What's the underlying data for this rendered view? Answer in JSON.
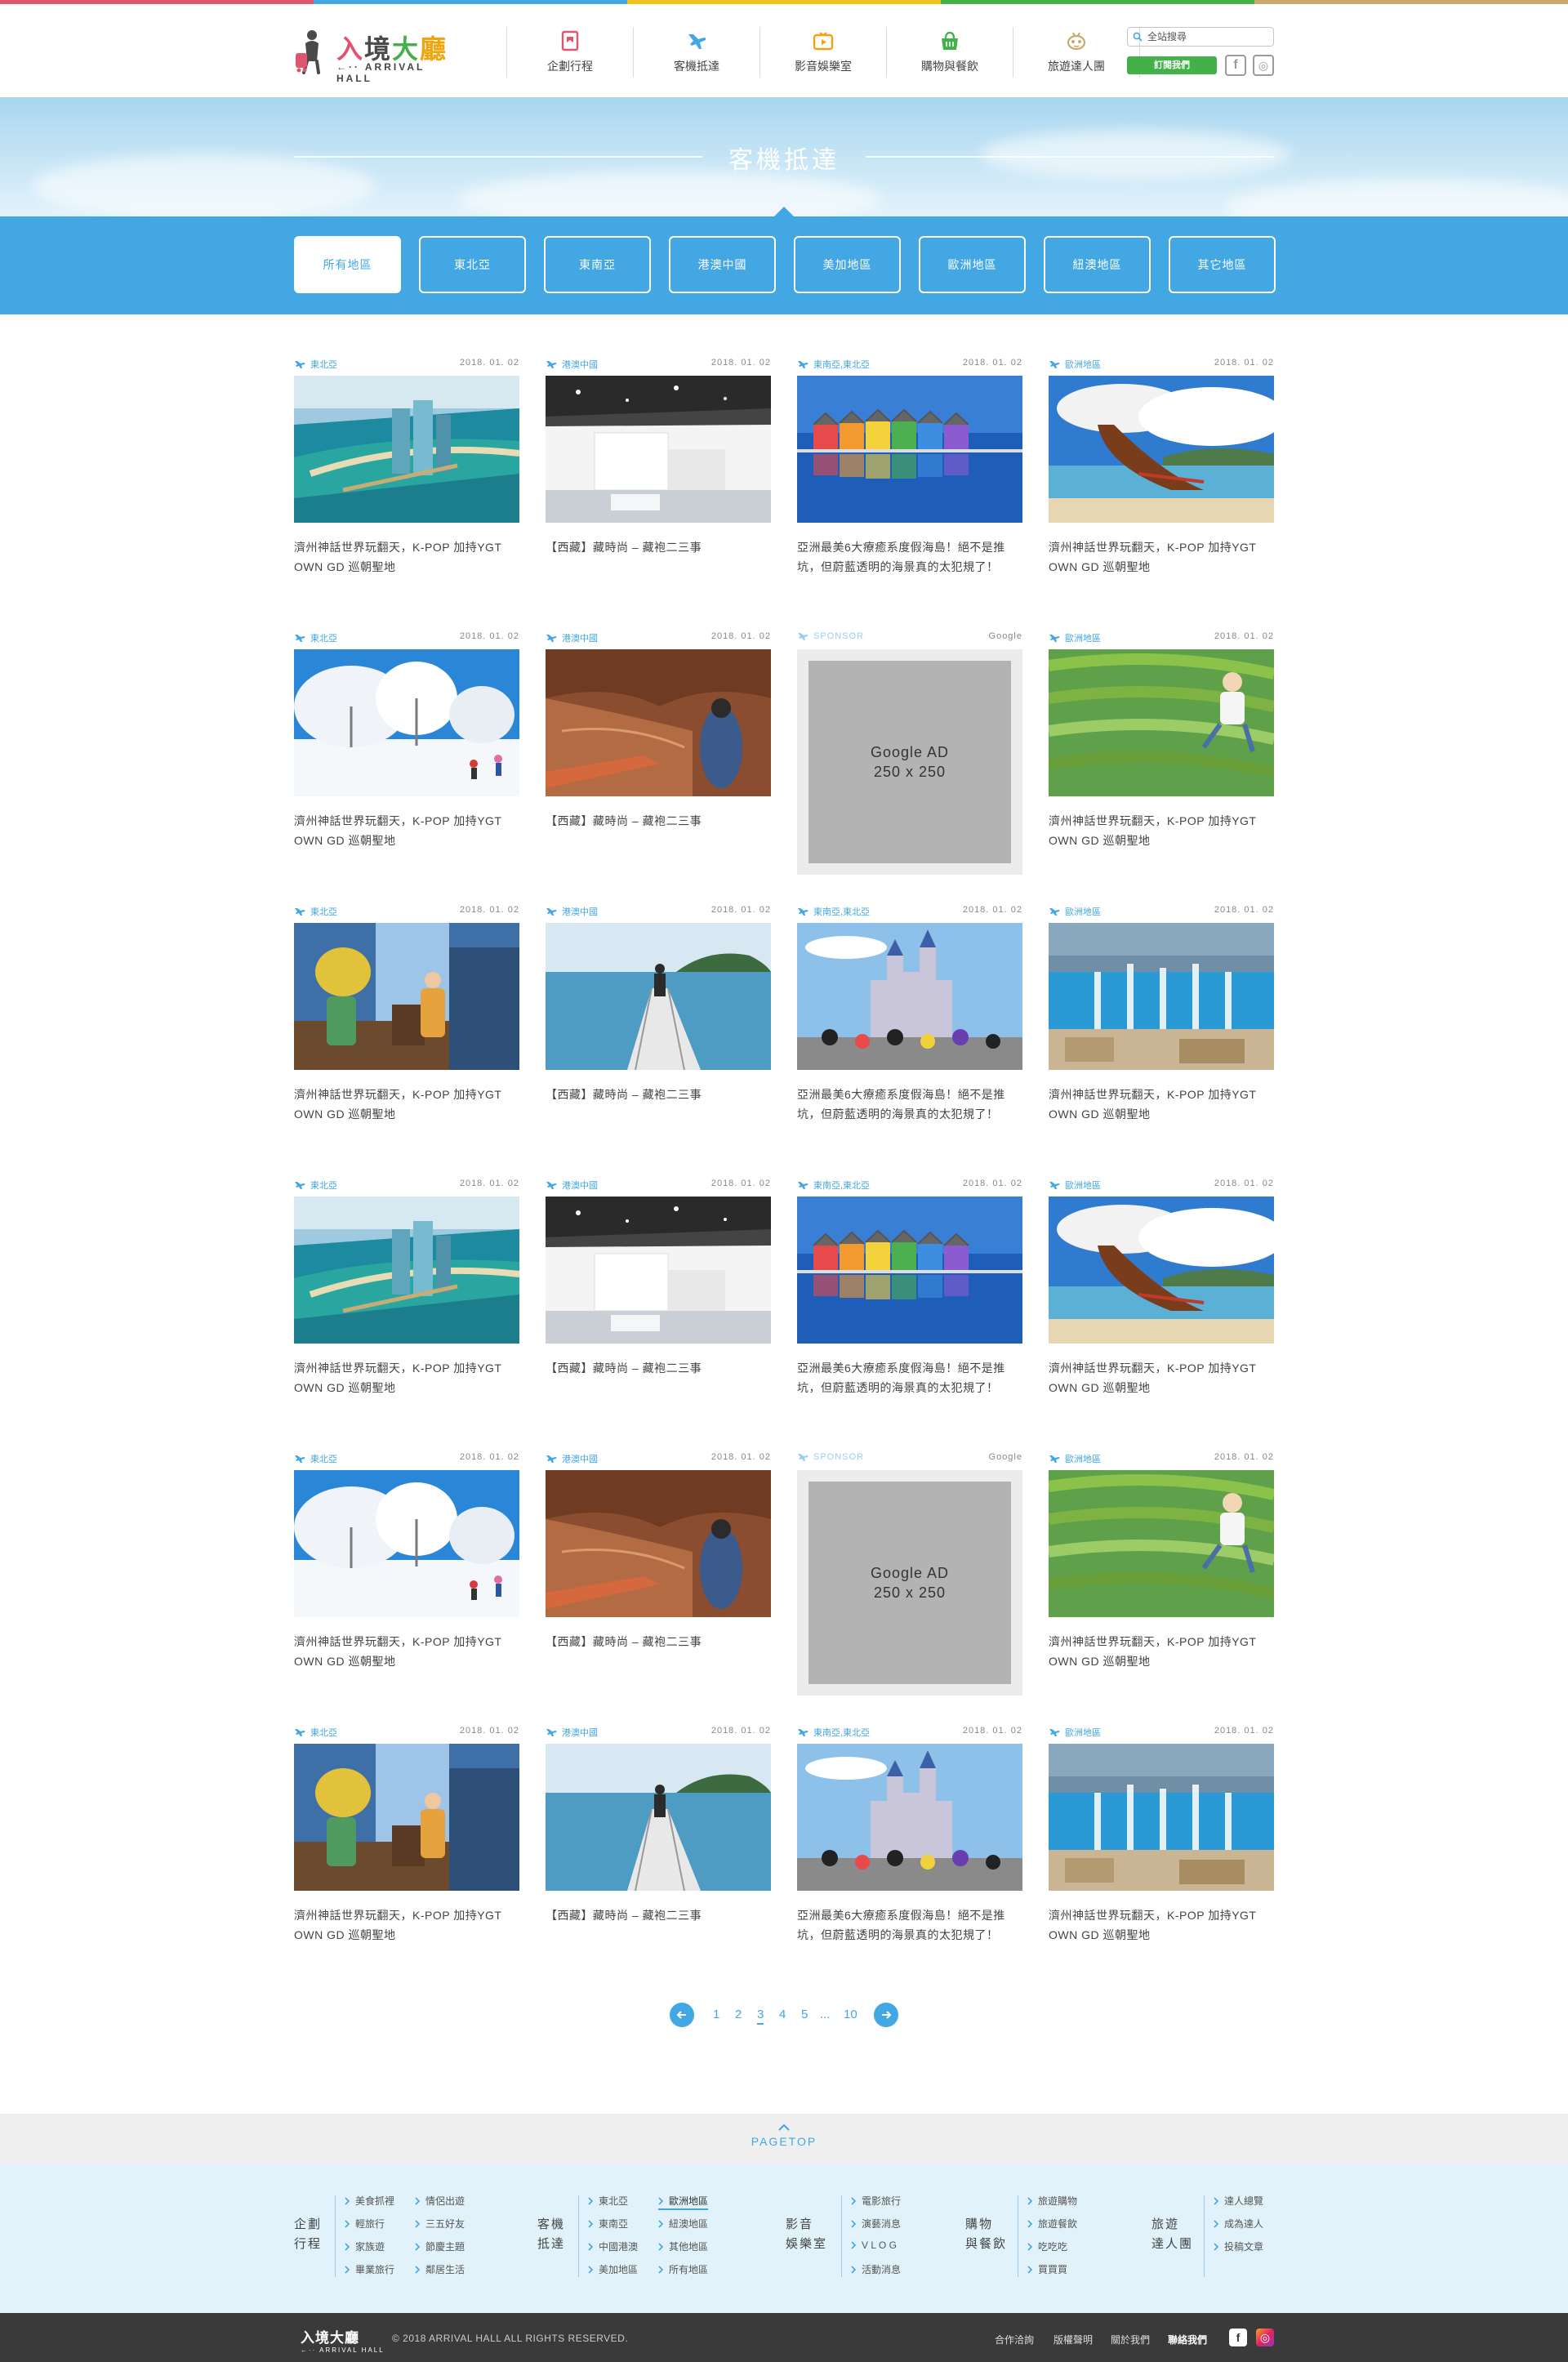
{
  "colors": {
    "accent": "#42a7e2",
    "green": "#43b04a",
    "stripe": [
      "#e05470",
      "#42a7e2",
      "#f0c419",
      "#43b04a",
      "#c9a96e"
    ],
    "footer_bg": "#3a3a3a"
  },
  "header": {
    "logo_title": [
      "入",
      "境",
      "大",
      "廳"
    ],
    "logo_sub": "←·· ARRIVAL HALL",
    "nav": [
      {
        "label": "企劃行程",
        "icon": "ribbon-card-icon",
        "color": "#e05470"
      },
      {
        "label": "客機抵達",
        "icon": "airplane-icon",
        "color": "#42a7e2"
      },
      {
        "label": "影音娛樂室",
        "icon": "tv-play-icon",
        "color": "#f0a40b"
      },
      {
        "label": "購物與餐飲",
        "icon": "shopping-basket-icon",
        "color": "#43b04a"
      },
      {
        "label": "旅遊達人團",
        "icon": "bee-icon",
        "color": "#c9a96e"
      }
    ],
    "search_placeholder": "全站搜尋",
    "subscribe_label": "訂閱我們",
    "facebook": "f",
    "instagram": "◎"
  },
  "banner": {
    "title": "客機抵達"
  },
  "filters": [
    "所有地區",
    "東北亞",
    "東南亞",
    "港澳中國",
    "美加地區",
    "歐洲地區",
    "紐澳地區",
    "其它地區"
  ],
  "cards": [
    {
      "cat": "東北亞",
      "date": "2018. 01. 02",
      "title": "濟州神話世界玩翻天，K-POP 加持YGT OWN GD 巡朝聖地",
      "img": "resort"
    },
    {
      "cat": "港澳中國",
      "date": "2018. 01. 02",
      "title": "【西藏】藏時尚 – 藏袍二三事",
      "img": "museum"
    },
    {
      "cat": "東南亞,東北亞",
      "date": "2018. 01. 02",
      "title": "亞洲最美6大療癒系度假海島！絕不是推坑，但蔚藍透明的海景真的太犯規了！",
      "img": "rainbow"
    },
    {
      "cat": "歐洲地區",
      "date": "2018. 01. 02",
      "title": "濟州神話世界玩翻天，K-POP 加持YGT OWN GD 巡朝聖地",
      "img": "boat"
    },
    {
      "cat": "東北亞",
      "date": "2018. 01. 02",
      "title": "濟州神話世界玩翻天，K-POP 加持YGT OWN GD 巡朝聖地",
      "img": "snow"
    },
    {
      "cat": "港澳中國",
      "date": "2018. 01. 02",
      "title": "【西藏】藏時尚 – 藏袍二三事",
      "img": "canyon"
    },
    {
      "cat": "SPONSOR",
      "date": "Google",
      "title": "",
      "img": "ad",
      "ad_line1": "Google AD",
      "ad_line2": "250 x 250"
    },
    {
      "cat": "歐洲地區",
      "date": "2018. 01. 02",
      "title": "濟州神話世界玩翻天，K-POP 加持YGT OWN GD 巡朝聖地",
      "img": "terrace"
    },
    {
      "cat": "東北亞",
      "date": "2018. 01. 02",
      "title": "濟州神話世界玩翻天，K-POP 加持YGT OWN GD 巡朝聖地",
      "img": "interior"
    },
    {
      "cat": "港澳中國",
      "date": "2018. 01. 02",
      "title": "【西藏】藏時尚 – 藏袍二三事",
      "img": "pier"
    },
    {
      "cat": "東南亞,東北亞",
      "date": "2018. 01. 02",
      "title": "亞洲最美6大療癒系度假海島！絕不是推坑，但蔚藍透明的海景真的太犯規了！",
      "img": "castle"
    },
    {
      "cat": "歐洲地區",
      "date": "2018. 01. 02",
      "title": "濟州神話世界玩翻天，K-POP 加持YGT OWN GD 巡朝聖地",
      "img": "fountain"
    },
    {
      "cat": "東北亞",
      "date": "2018. 01. 02",
      "title": "濟州神話世界玩翻天，K-POP 加持YGT OWN GD 巡朝聖地",
      "img": "resort"
    },
    {
      "cat": "港澳中國",
      "date": "2018. 01. 02",
      "title": "【西藏】藏時尚 – 藏袍二三事",
      "img": "museum"
    },
    {
      "cat": "東南亞,東北亞",
      "date": "2018. 01. 02",
      "title": "亞洲最美6大療癒系度假海島！絕不是推坑，但蔚藍透明的海景真的太犯規了！",
      "img": "rainbow"
    },
    {
      "cat": "歐洲地區",
      "date": "2018. 01. 02",
      "title": "濟州神話世界玩翻天，K-POP 加持YGT OWN GD 巡朝聖地",
      "img": "boat"
    },
    {
      "cat": "東北亞",
      "date": "2018. 01. 02",
      "title": "濟州神話世界玩翻天，K-POP 加持YGT OWN GD 巡朝聖地",
      "img": "snow"
    },
    {
      "cat": "港澳中國",
      "date": "2018. 01. 02",
      "title": "【西藏】藏時尚 – 藏袍二三事",
      "img": "canyon"
    },
    {
      "cat": "SPONSOR",
      "date": "Google",
      "title": "",
      "img": "ad",
      "ad_line1": "Google AD",
      "ad_line2": "250 x 250"
    },
    {
      "cat": "歐洲地區",
      "date": "2018. 01. 02",
      "title": "濟州神話世界玩翻天，K-POP 加持YGT OWN GD 巡朝聖地",
      "img": "terrace"
    },
    {
      "cat": "東北亞",
      "date": "2018. 01. 02",
      "title": "濟州神話世界玩翻天，K-POP 加持YGT OWN GD 巡朝聖地",
      "img": "interior"
    },
    {
      "cat": "港澳中國",
      "date": "2018. 01. 02",
      "title": "【西藏】藏時尚 – 藏袍二三事",
      "img": "pier"
    },
    {
      "cat": "東南亞,東北亞",
      "date": "2018. 01. 02",
      "title": "亞洲最美6大療癒系度假海島！絕不是推坑，但蔚藍透明的海景真的太犯規了！",
      "img": "castle"
    },
    {
      "cat": "歐洲地區",
      "date": "2018. 01. 02",
      "title": "濟州神話世界玩翻天，K-POP 加持YGT OWN GD 巡朝聖地",
      "img": "fountain"
    }
  ],
  "pagination": {
    "pages": [
      "1",
      "2",
      "3",
      "4",
      "5",
      "...",
      "10"
    ],
    "current": "3"
  },
  "pagetop": "PAGETOP",
  "sitemap": {
    "groups": [
      {
        "head": [
          "企劃",
          "行程"
        ],
        "cols": [
          [
            "美食抓裡",
            "輕旅行",
            "家族遊",
            "畢業旅行"
          ],
          [
            "情侶出遊",
            "三五好友",
            "節慶主題",
            "鄰居生活"
          ]
        ]
      },
      {
        "head": [
          "客機",
          "抵達"
        ],
        "cols": [
          [
            "東北亞",
            "東南亞",
            "中國港澳",
            "美加地區"
          ],
          [
            "歐洲地區",
            "紐澳地區",
            "其他地區",
            "所有地區"
          ]
        ]
      },
      {
        "head": [
          "影音",
          "娛樂室"
        ],
        "cols": [
          [
            "電影旅行",
            "演藝消息",
            "V L O G",
            "活動消息"
          ]
        ]
      },
      {
        "head": [
          "購物",
          "與餐飲"
        ],
        "cols": [
          [
            "旅遊購物",
            "旅遊餐飲",
            "吃吃吃",
            "買買買"
          ]
        ]
      },
      {
        "head": [
          "旅遊",
          "達人團"
        ],
        "cols": [
          [
            "達人總覽",
            "成為達人",
            "投稿文章"
          ]
        ]
      }
    ],
    "active": "歐洲地區"
  },
  "footer": {
    "logo": "入境大廳",
    "logo_sub": "←·· ARRIVAL HALL",
    "copyright": "© 2018 ARRIVAL HALL ALL RIGHTS RESERVED.",
    "links": [
      "合作洽詢",
      "版權聲明",
      "關於我們",
      "聯絡我們"
    ],
    "facebook": "f",
    "instagram": "◎"
  }
}
